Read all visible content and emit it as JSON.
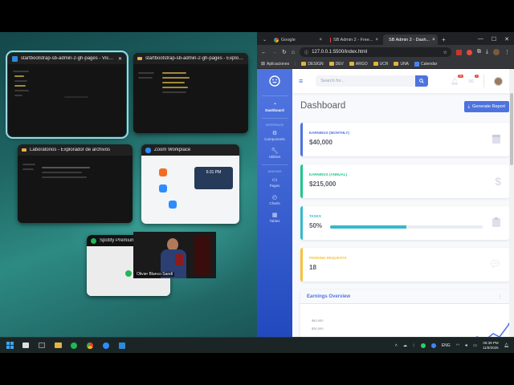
{
  "snap_assist": {
    "windows": [
      {
        "title": "startbootstrap-sb-admin-2-gh-pages - Visual...",
        "close": "✕"
      },
      {
        "title": "startbootstrap-sb-admin-2-gh-pages - Explorador de..."
      },
      {
        "title": "Laboratorios - Explorador de archivos"
      },
      {
        "title": "Zoom Workplace",
        "time": "6:31 PM"
      },
      {
        "title": "Spotify Premium",
        "camera_name": "Olivier Blanco Sandí"
      }
    ]
  },
  "browser": {
    "tabs": [
      {
        "label": "Google"
      },
      {
        "label": "SB Admin 2 - Free..."
      },
      {
        "label": "SB Admin 2 - Dash..."
      }
    ],
    "url": "127.0.0.1:5500/index.html",
    "bookmarks": [
      "Aplicaciones",
      "DESIGN",
      "DEV",
      "ARGO",
      "UCR",
      "UNA",
      "Calendar"
    ]
  },
  "dashboard": {
    "search_placeholder": "Search for...",
    "alerts_count": "3+",
    "messages_count": "7",
    "title": "Dashboard",
    "generate_report": "Generate Report",
    "sidebar": {
      "items": [
        {
          "label": "Dashboard",
          "icon": "gauge-icon"
        },
        {
          "heading": "INTERFACE"
        },
        {
          "label": "Components",
          "icon": "gear-icon"
        },
        {
          "label": "Utilities",
          "icon": "wrench-icon"
        },
        {
          "heading": "ADDONS"
        },
        {
          "label": "Pages",
          "icon": "folder-icon"
        },
        {
          "label": "Charts",
          "icon": "chart-icon"
        },
        {
          "label": "Tables",
          "icon": "table-icon"
        }
      ]
    },
    "cards": [
      {
        "label": "EARNINGS (MONTHLY)",
        "value": "$40,000",
        "color": "#4e73df"
      },
      {
        "label": "EARNINGS (ANNUAL)",
        "value": "$215,000",
        "color": "#1cc88a"
      },
      {
        "label": "TASKS",
        "value": "50%",
        "progress": 0.5,
        "color": "#36b9cc"
      },
      {
        "label": "PENDING REQUESTS",
        "value": "18",
        "color": "#f6c23e"
      }
    ],
    "overview_title": "Earnings Overview",
    "overview_ticks": [
      "$40,000",
      "$30,000"
    ]
  },
  "taskbar": {
    "lang": "ENG",
    "time": "06:39 PM",
    "date": "11/8/2026"
  }
}
